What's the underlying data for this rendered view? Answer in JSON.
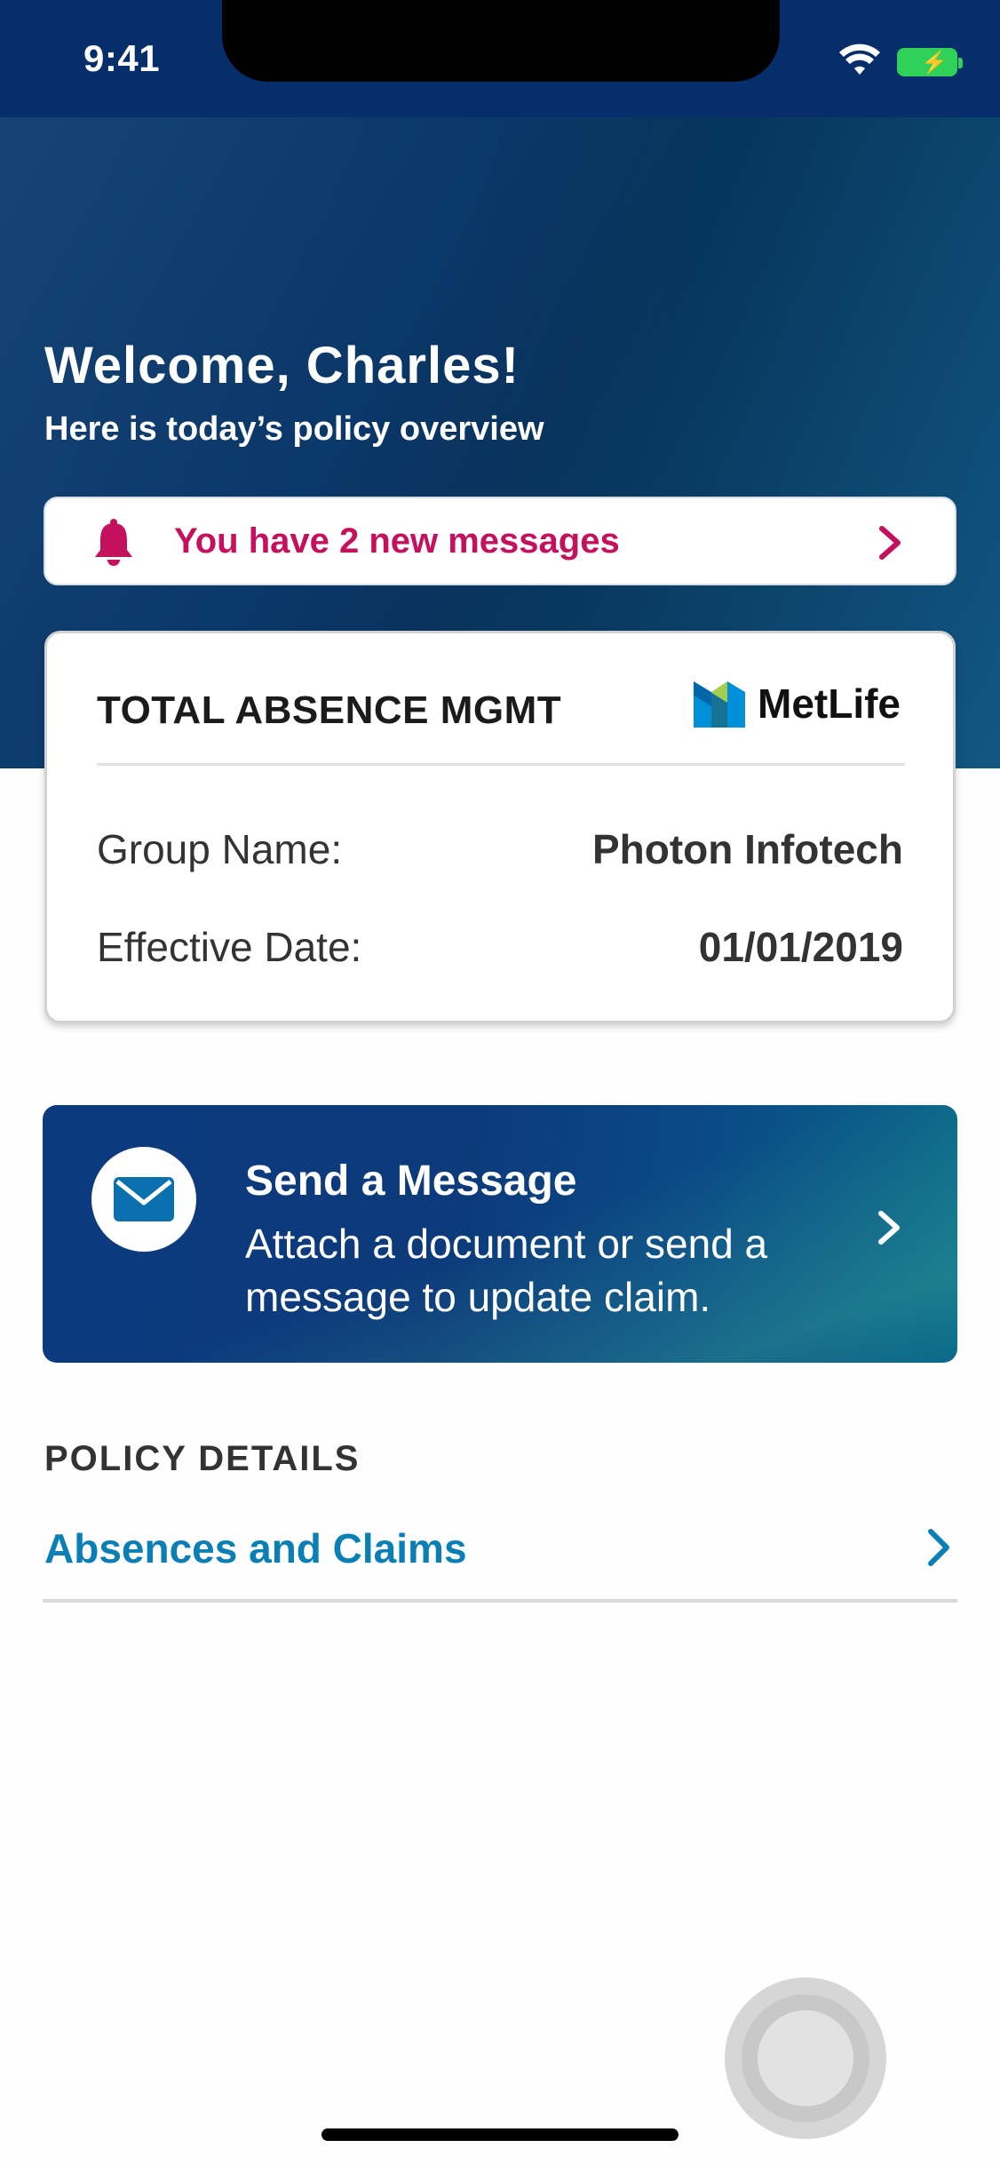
{
  "status_bar": {
    "time": "9:41"
  },
  "header": {
    "welcome": "Welcome, Charles!",
    "subtitle": "Here is today’s policy overview"
  },
  "messages_banner": {
    "text": "You have 2 new messages"
  },
  "policy_card": {
    "title": "TOTAL ABSENCE MGMT",
    "brand": "MetLife",
    "rows": [
      {
        "label": "Group Name:",
        "value": "Photon Infotech"
      },
      {
        "label": "Effective Date:",
        "value": "01/01/2019"
      }
    ]
  },
  "send_message": {
    "title": "Send a Message",
    "subtitle": "Attach a document or send a message to update claim."
  },
  "policy_details": {
    "heading": "POLICY DETAILS",
    "items": [
      {
        "label": "Absences and Claims"
      }
    ]
  },
  "colors": {
    "hero": "#0a3767",
    "status_bar": "#052e6a",
    "alert": "#c4105d",
    "link": "#0a7fb5"
  },
  "icons": [
    "wifi-icon",
    "battery-icon",
    "bell-icon",
    "chevron-right-icon",
    "metlife-logo",
    "mail-icon"
  ]
}
